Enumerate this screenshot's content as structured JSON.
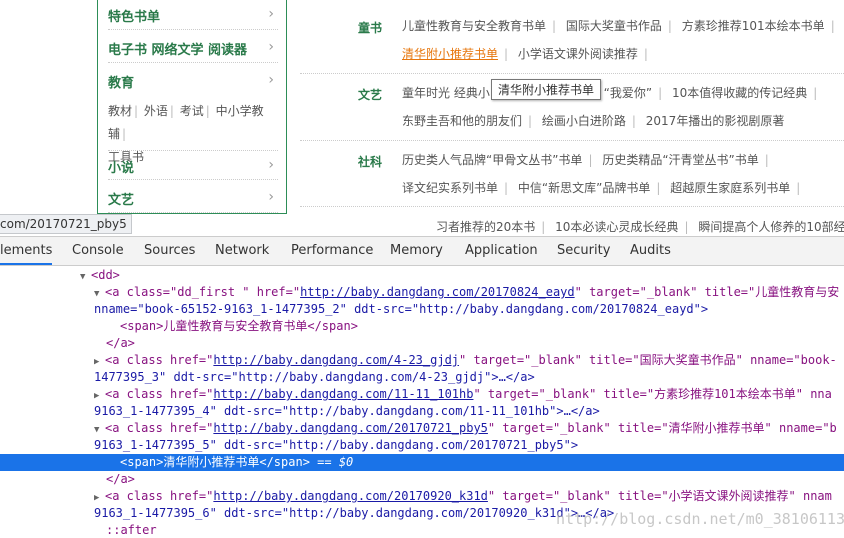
{
  "left_nav": {
    "cats": [
      "特色书单",
      "电子书 网络文学 阅读器",
      "教育",
      "小说",
      "文艺"
    ],
    "edu_sub": [
      "教材",
      "外语",
      "考试",
      "中小学教辅",
      "工具书"
    ]
  },
  "content": {
    "rows": [
      {
        "label": "童书",
        "lines": [
          [
            "儿童性教育与安全教育书单",
            "国际大奖童书作品",
            "方素珍推荐101本绘本书单"
          ],
          [
            "清华附小推荐书单",
            "小学语文课外阅读推荐"
          ]
        ]
      },
      {
        "label": "文艺",
        "lines": [
          [
            "童年时光 经典小",
            "“我爱你”",
            "10本值得收藏的传记经典"
          ],
          [
            "东野圭吾和他的朋友们",
            "绘画小白进阶路",
            "2017年播出的影视剧原著"
          ]
        ]
      },
      {
        "label": "社科",
        "lines": [
          [
            "历史类人气品牌“甲骨文丛书”书单",
            "历史类精品“汗青堂丛书”书单"
          ],
          [
            "译文纪实系列书单",
            "中信“新思文库”品牌书单",
            "超越原生家庭系列书单"
          ],
          [
            "习者推荐的20本书",
            "10本必读心灵成长经典",
            "瞬间提高个人修养的10部经典"
          ]
        ]
      }
    ],
    "tooltip": "清华附小推荐书单"
  },
  "statusbar": {
    "url": "com/20170721_pby5"
  },
  "devtools": {
    "tabs": [
      "lements",
      "Console",
      "Sources",
      "Network",
      "Performance",
      "Memory",
      "Application",
      "Security",
      "Audits"
    ],
    "dom": {
      "dd": "<dd>",
      "a1_open_a": "<a class=\"dd_first \" href=\"",
      "a1_href": "http://baby.dangdang.com/20170824_eayd",
      "a1_open_b": "\" target=\"_blank\" title=\"儿童性教育与安",
      "a1_cont": "nname=\"book-65152-9163_1-1477395_2\" ddt-src=\"http://baby.dangdang.com/20170824_eayd\">",
      "a1_span": "<span>儿童性教育与安全教育书单</span>",
      "a_close": "</a>",
      "a2_a": "<a class href=\"",
      "a2_href": "http://baby.dangdang.com/4-23_gjdj",
      "a2_b": "\" target=\"_blank\" title=\"国际大奖童书作品\" nname=\"book-",
      "a2_cont": "1477395_3\" ddt-src=\"http://baby.dangdang.com/4-23_gjdj\">…</a>",
      "a3_a": "<a class href=\"",
      "a3_href": "http://baby.dangdang.com/11-11_101hb",
      "a3_b": "\" target=\"_blank\" title=\"方素珍推荐101本绘本书单\" nna",
      "a3_cont": "9163_1-1477395_4\" ddt-src=\"http://baby.dangdang.com/11-11_101hb\">…</a>",
      "a4_a": "<a class href=\"",
      "a4_href": "http://baby.dangdang.com/20170721_pby5",
      "a4_b": "\" target=\"_blank\" title=\"清华附小推荐书单\" nname=\"b",
      "a4_cont": "9163_1-1477395_5\" ddt-src=\"http://baby.dangdang.com/20170721_pby5\">",
      "a4_span": "<span>清华附小推荐书单</span>",
      "a4_eq": "== $0",
      "a5_a": "<a class href=\"",
      "a5_href": "http://baby.dangdang.com/20170920_k31d",
      "a5_b": "\" target=\"_blank\" title=\"小学语文课外阅读推荐\" nnam",
      "a5_cont": "9163_1-1477395_6\" ddt-src=\"http://baby.dangdang.com/20170920_k31d\">…</a>",
      "after": "::after"
    },
    "watermark": "http://blog.csdn.net/m0_38106113"
  },
  "colors": {
    "accent": "#1a73e8",
    "nav_green": "#2a7a4a",
    "link_orange": "#e7760c"
  }
}
